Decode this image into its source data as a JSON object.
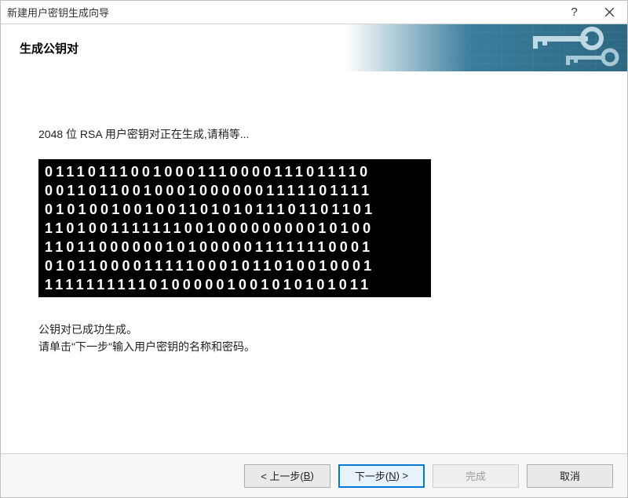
{
  "window": {
    "title": "新建用户密钥生成向导"
  },
  "banner": {
    "title": "生成公钥对"
  },
  "content": {
    "status": "2048 位 RSA 用户密钥对正在生成,请稍等...",
    "binary_rows": [
      "011101110010001110000111011110",
      "001101100100010000001111101111",
      "010100100100110101011101101101",
      "110100111111100100000000010100",
      "110110000001010000011111110001",
      "010110000111110001011010010001",
      "111111111101000001001010101011"
    ],
    "success_line1": "公钥对已成功生成。",
    "success_line2": "请单击\"下一步\"输入用户密钥的名称和密码。"
  },
  "buttons": {
    "back_prefix": "< 上一步(",
    "back_hotkey": "B",
    "back_suffix": ")",
    "next_prefix": "下一步(",
    "next_hotkey": "N",
    "next_suffix": ") >",
    "finish": "完成",
    "cancel": "取消"
  }
}
